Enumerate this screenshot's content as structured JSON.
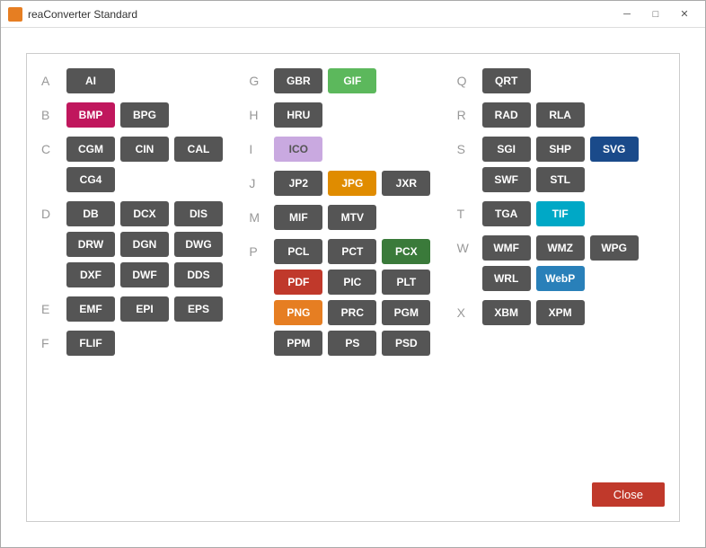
{
  "titlebar": {
    "title": "reaConverter Standard",
    "min_label": "─",
    "max_label": "□",
    "close_label": "✕"
  },
  "close_btn": "Close",
  "columns": [
    {
      "sections": [
        {
          "letter": "A",
          "formats": [
            {
              "label": "AI",
              "color": "gray"
            }
          ]
        },
        {
          "letter": "B",
          "formats": [
            {
              "label": "BMP",
              "color": "magenta"
            },
            {
              "label": "BPG",
              "color": "gray"
            }
          ]
        },
        {
          "letter": "C",
          "formats": [
            {
              "label": "CGM",
              "color": "gray"
            },
            {
              "label": "CIN",
              "color": "gray"
            },
            {
              "label": "CAL",
              "color": "gray"
            },
            {
              "label": "CG4",
              "color": "gray"
            }
          ]
        },
        {
          "letter": "D",
          "formats": [
            {
              "label": "DB",
              "color": "gray"
            },
            {
              "label": "DCX",
              "color": "gray"
            },
            {
              "label": "DIS",
              "color": "gray"
            },
            {
              "label": "DRW",
              "color": "gray"
            },
            {
              "label": "DGN",
              "color": "gray"
            },
            {
              "label": "DWG",
              "color": "gray"
            },
            {
              "label": "DXF",
              "color": "gray"
            },
            {
              "label": "DWF",
              "color": "gray"
            },
            {
              "label": "DDS",
              "color": "gray"
            }
          ]
        },
        {
          "letter": "E",
          "formats": [
            {
              "label": "EMF",
              "color": "gray"
            },
            {
              "label": "EPI",
              "color": "gray"
            },
            {
              "label": "EPS",
              "color": "gray"
            }
          ]
        },
        {
          "letter": "F",
          "formats": [
            {
              "label": "FLIF",
              "color": "gray"
            }
          ]
        }
      ]
    },
    {
      "sections": [
        {
          "letter": "G",
          "formats": [
            {
              "label": "GBR",
              "color": "gray"
            },
            {
              "label": "GIF",
              "color": "green"
            }
          ]
        },
        {
          "letter": "H",
          "formats": [
            {
              "label": "HRU",
              "color": "gray"
            }
          ]
        },
        {
          "letter": "I",
          "formats": [
            {
              "label": "ICO",
              "color": "lavender"
            }
          ]
        },
        {
          "letter": "J",
          "formats": [
            {
              "label": "JP2",
              "color": "gray"
            },
            {
              "label": "JPG",
              "color": "orange"
            },
            {
              "label": "JXR",
              "color": "gray"
            }
          ]
        },
        {
          "letter": "M",
          "formats": [
            {
              "label": "MIF",
              "color": "gray"
            },
            {
              "label": "MTV",
              "color": "gray"
            }
          ]
        },
        {
          "letter": "P",
          "formats": [
            {
              "label": "PCL",
              "color": "gray"
            },
            {
              "label": "PCT",
              "color": "gray"
            },
            {
              "label": "PCX",
              "color": "dark-green"
            },
            {
              "label": "PDF",
              "color": "red"
            },
            {
              "label": "PIC",
              "color": "gray"
            },
            {
              "label": "PLT",
              "color": "gray"
            },
            {
              "label": "PNG",
              "color": "orange-bright"
            },
            {
              "label": "PRC",
              "color": "gray"
            },
            {
              "label": "PGM",
              "color": "gray"
            },
            {
              "label": "PPM",
              "color": "gray"
            },
            {
              "label": "PS",
              "color": "gray"
            },
            {
              "label": "PSD",
              "color": "gray"
            }
          ]
        }
      ]
    },
    {
      "sections": [
        {
          "letter": "Q",
          "formats": [
            {
              "label": "QRT",
              "color": "gray"
            }
          ]
        },
        {
          "letter": "R",
          "formats": [
            {
              "label": "RAD",
              "color": "gray"
            },
            {
              "label": "RLA",
              "color": "gray"
            }
          ]
        },
        {
          "letter": "S",
          "formats": [
            {
              "label": "SGI",
              "color": "gray"
            },
            {
              "label": "SHP",
              "color": "gray"
            },
            {
              "label": "SVG",
              "color": "svg-blue"
            },
            {
              "label": "SWF",
              "color": "gray"
            },
            {
              "label": "STL",
              "color": "gray"
            }
          ]
        },
        {
          "letter": "T",
          "formats": [
            {
              "label": "TGA",
              "color": "gray"
            },
            {
              "label": "TIF",
              "color": "cyan"
            }
          ]
        },
        {
          "letter": "W",
          "formats": [
            {
              "label": "WMF",
              "color": "gray"
            },
            {
              "label": "WMZ",
              "color": "gray"
            },
            {
              "label": "WPG",
              "color": "gray"
            },
            {
              "label": "WRL",
              "color": "gray"
            },
            {
              "label": "WebP",
              "color": "webp-blue"
            }
          ]
        },
        {
          "letter": "X",
          "formats": [
            {
              "label": "XBM",
              "color": "gray"
            },
            {
              "label": "XPM",
              "color": "gray"
            }
          ]
        }
      ]
    }
  ]
}
